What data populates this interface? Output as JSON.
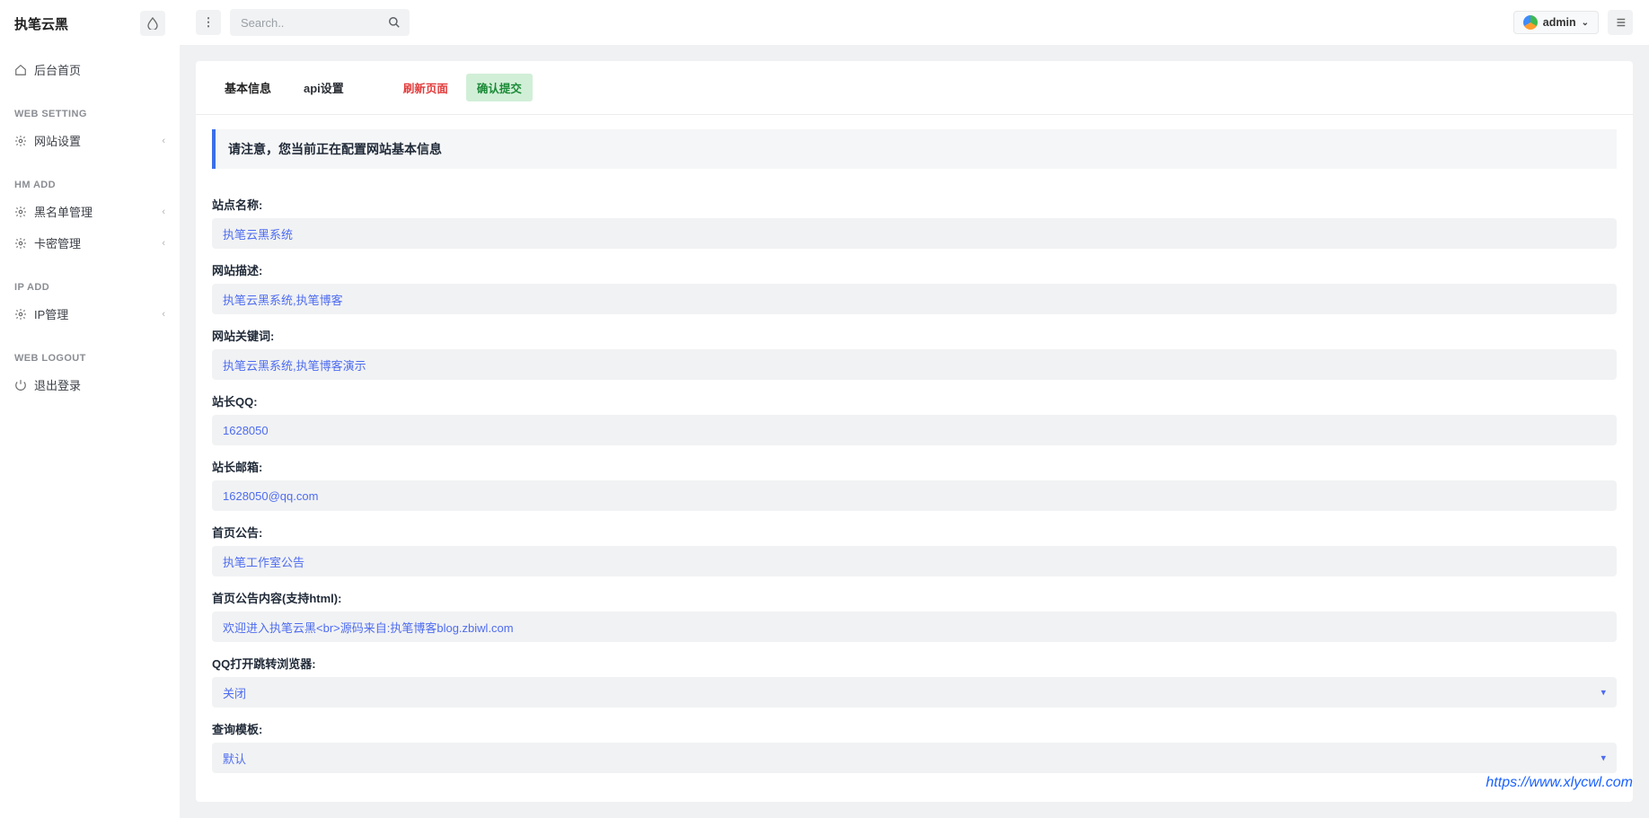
{
  "site": {
    "title": "执笔云黑"
  },
  "sidebar": {
    "home": "后台首页",
    "sections": [
      {
        "heading": "WEB SETTING",
        "items": [
          {
            "label": "网站设置",
            "expandable": true
          }
        ]
      },
      {
        "heading": "HM ADD",
        "items": [
          {
            "label": "黑名单管理",
            "expandable": true
          },
          {
            "label": "卡密管理",
            "expandable": true
          }
        ]
      },
      {
        "heading": "IP ADD",
        "items": [
          {
            "label": "IP管理",
            "expandable": true
          }
        ]
      },
      {
        "heading": "WEB LOGOUT",
        "items": [
          {
            "label": "退出登录",
            "expandable": false
          }
        ]
      }
    ]
  },
  "topbar": {
    "search_placeholder": "Search..",
    "user_name": "admin"
  },
  "tabs": {
    "basic": "基本信息",
    "api": "api设置",
    "refresh": "刷新页面",
    "submit": "确认提交"
  },
  "notice": "请注意，您当前正在配置网站基本信息",
  "form": {
    "site_name": {
      "label": "站点名称:",
      "value": "执笔云黑系统"
    },
    "site_desc": {
      "label": "网站描述:",
      "value": "执笔云黑系统,执笔博客"
    },
    "site_keywords": {
      "label": "网站关键词:",
      "value": "执笔云黑系统,执笔博客演示"
    },
    "admin_qq": {
      "label": "站长QQ:",
      "value": "1628050"
    },
    "admin_email": {
      "label": "站长邮箱:",
      "value": "1628050@qq.com"
    },
    "home_notice": {
      "label": "首页公告:",
      "value": "执笔工作室公告"
    },
    "home_notice_content": {
      "label": "首页公告内容(支持html):",
      "value": "欢迎进入执笔云黑<br>源码来自:执笔博客blog.zbiwl.com"
    },
    "qq_jump": {
      "label": "QQ打开跳转浏览器:",
      "selected": "关闭"
    },
    "query_template": {
      "label": "查询模板:",
      "selected": "默认"
    }
  },
  "watermark": "https://www.xlycwl.com"
}
